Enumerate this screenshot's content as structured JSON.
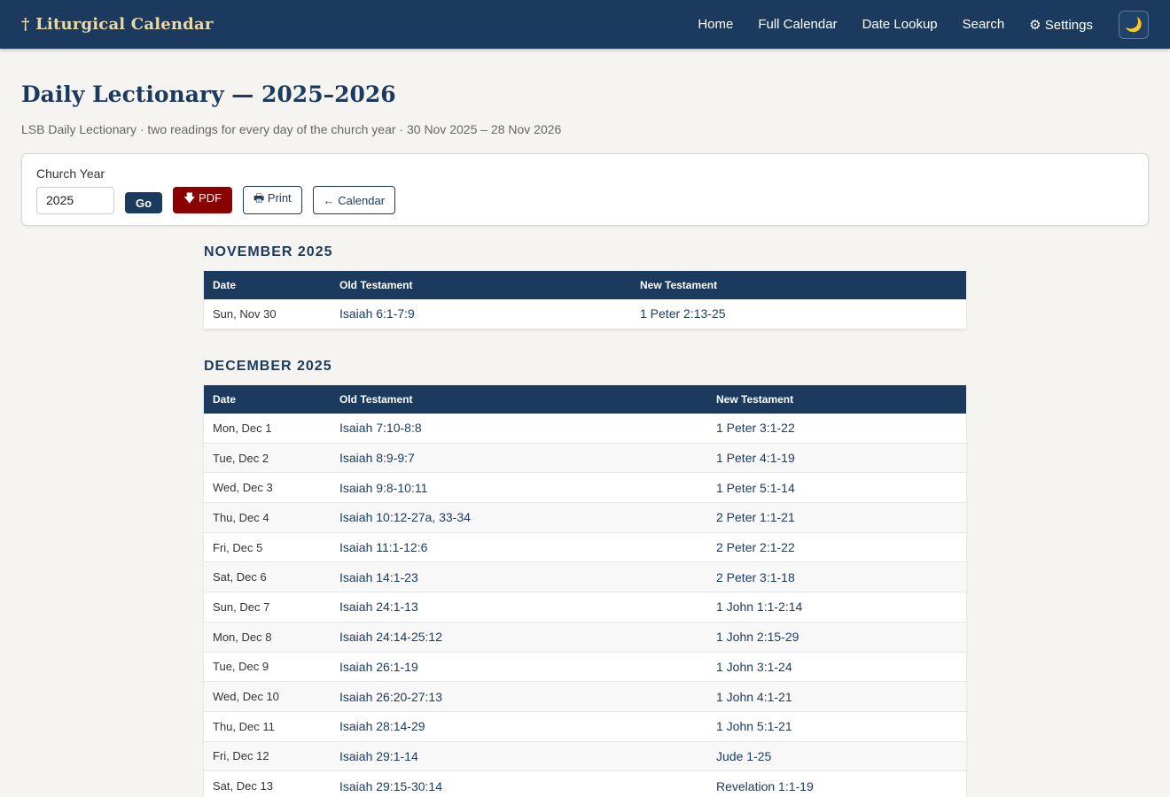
{
  "header": {
    "brand": "† Liturgical Calendar",
    "nav": [
      "Home",
      "Full Calendar",
      "Date Lookup",
      "Search",
      "⚙ Settings"
    ],
    "theme_icon": "moon-icon"
  },
  "page": {
    "title": "Daily Lectionary — 2025–2026",
    "subtitle": "LSB Daily Lectionary · two readings for every day of the church year · 30 Nov 2025 – 28 Nov 2026"
  },
  "controls": {
    "year_label": "Church Year",
    "year_value": "2025",
    "go_label": "Go",
    "pdf_label": "🡇 PDF",
    "print_label": "🖶 Print",
    "calendar_label": "← Calendar"
  },
  "columns": {
    "date": "Date",
    "ot": "Old Testament",
    "nt": "New Testament"
  },
  "months": [
    {
      "title": "NOVEMBER 2025",
      "rows": [
        {
          "date": "Sun, Nov 30",
          "ot": "Isaiah 6:1-7:9",
          "nt": "1 Peter 2:13-25"
        }
      ]
    },
    {
      "title": "DECEMBER 2025",
      "rows": [
        {
          "date": "Mon, Dec 1",
          "ot": "Isaiah 7:10-8:8",
          "nt": "1 Peter 3:1-22"
        },
        {
          "date": "Tue, Dec 2",
          "ot": "Isaiah 8:9-9:7",
          "nt": "1 Peter 4:1-19"
        },
        {
          "date": "Wed, Dec 3",
          "ot": "Isaiah 9:8-10:11",
          "nt": "1 Peter 5:1-14"
        },
        {
          "date": "Thu, Dec 4",
          "ot": "Isaiah 10:12-27a, 33-34",
          "nt": "2 Peter 1:1-21"
        },
        {
          "date": "Fri, Dec 5",
          "ot": "Isaiah 11:1-12:6",
          "nt": "2 Peter 2:1-22"
        },
        {
          "date": "Sat, Dec 6",
          "ot": "Isaiah 14:1-23",
          "nt": "2 Peter 3:1-18"
        },
        {
          "date": "Sun, Dec 7",
          "ot": "Isaiah 24:1-13",
          "nt": "1 John 1:1-2:14"
        },
        {
          "date": "Mon, Dec 8",
          "ot": "Isaiah 24:14-25:12",
          "nt": "1 John 2:15-29"
        },
        {
          "date": "Tue, Dec 9",
          "ot": "Isaiah 26:1-19",
          "nt": "1 John 3:1-24"
        },
        {
          "date": "Wed, Dec 10",
          "ot": "Isaiah 26:20-27:13",
          "nt": "1 John 4:1-21"
        },
        {
          "date": "Thu, Dec 11",
          "ot": "Isaiah 28:14-29",
          "nt": "1 John 5:1-21"
        },
        {
          "date": "Fri, Dec 12",
          "ot": "Isaiah 29:1-14",
          "nt": "Jude 1-25"
        },
        {
          "date": "Sat, Dec 13",
          "ot": "Isaiah 29:15-30:14",
          "nt": "Revelation 1:1-19"
        }
      ]
    }
  ]
}
